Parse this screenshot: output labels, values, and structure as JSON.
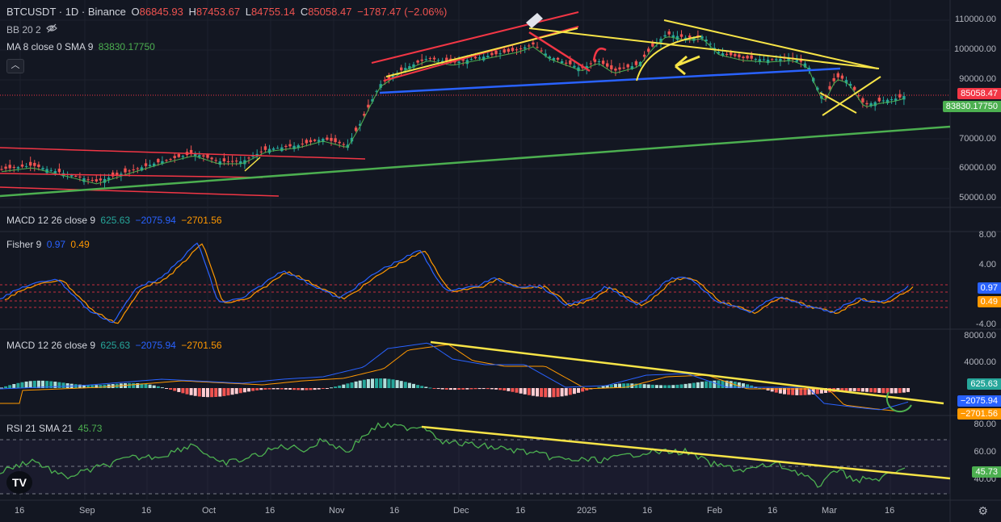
{
  "symbol": {
    "title": "BTCUSDT · 1D · Binance",
    "o_label": "O",
    "o": "86845.93",
    "h_label": "H",
    "h": "87453.67",
    "l_label": "L",
    "l": "84755.14",
    "c_label": "C",
    "c": "85058.47",
    "change": "−1787.47 (−2.06%)"
  },
  "indicators": {
    "bb": "BB 20 2",
    "ma_label": "MA 8 close 0 SMA 9",
    "ma_value": "83830.17750",
    "collapse_icon": "chevron-up-icon",
    "visibility_icon": "eye-off-icon"
  },
  "price_axis": [
    "110000.00",
    "100000.00",
    "90000.00",
    "80000.00",
    "70000.00",
    "60000.00",
    "50000.00"
  ],
  "price_tags": {
    "last": "85058.47",
    "ma": "83830.17750"
  },
  "macd_collapsed": {
    "label": "MACD 12 26 close 9",
    "v1": "625.63",
    "v2": "−2075.94",
    "v3": "−2701.56"
  },
  "fisher": {
    "label": "Fisher 9",
    "v1": "0.97",
    "v2": "0.49",
    "axis": [
      "8.00",
      "4.00",
      "-4.00"
    ]
  },
  "macd": {
    "label": "MACD 12 26 close 9",
    "v1": "625.63",
    "v2": "−2075.94",
    "v3": "−2701.56",
    "axis": [
      "8000.00",
      "4000.00"
    ],
    "tags": [
      "625.63",
      "−2075.94",
      "−2701.56"
    ]
  },
  "rsi": {
    "label": "RSI 21 SMA 21",
    "v1": "45.73",
    "axis": [
      "80.00",
      "60.00",
      "40.00"
    ],
    "tag": "45.73"
  },
  "time_axis": [
    "16",
    "Sep",
    "16",
    "Oct",
    "16",
    "Nov",
    "16",
    "Dec",
    "16",
    "2025",
    "16",
    "Feb",
    "16",
    "Mar",
    "16"
  ],
  "logo": "TV",
  "colors": {
    "bg": "#131722",
    "up": "#26a69a",
    "down": "#ef5350",
    "yellow": "#f7e447",
    "red_channel": "#f23645",
    "blue_line": "#2962ff",
    "green_line": "#4caf50",
    "macd_line": "#2962ff",
    "signal_line": "#ff9800",
    "rsi_line": "#4caf50"
  }
}
